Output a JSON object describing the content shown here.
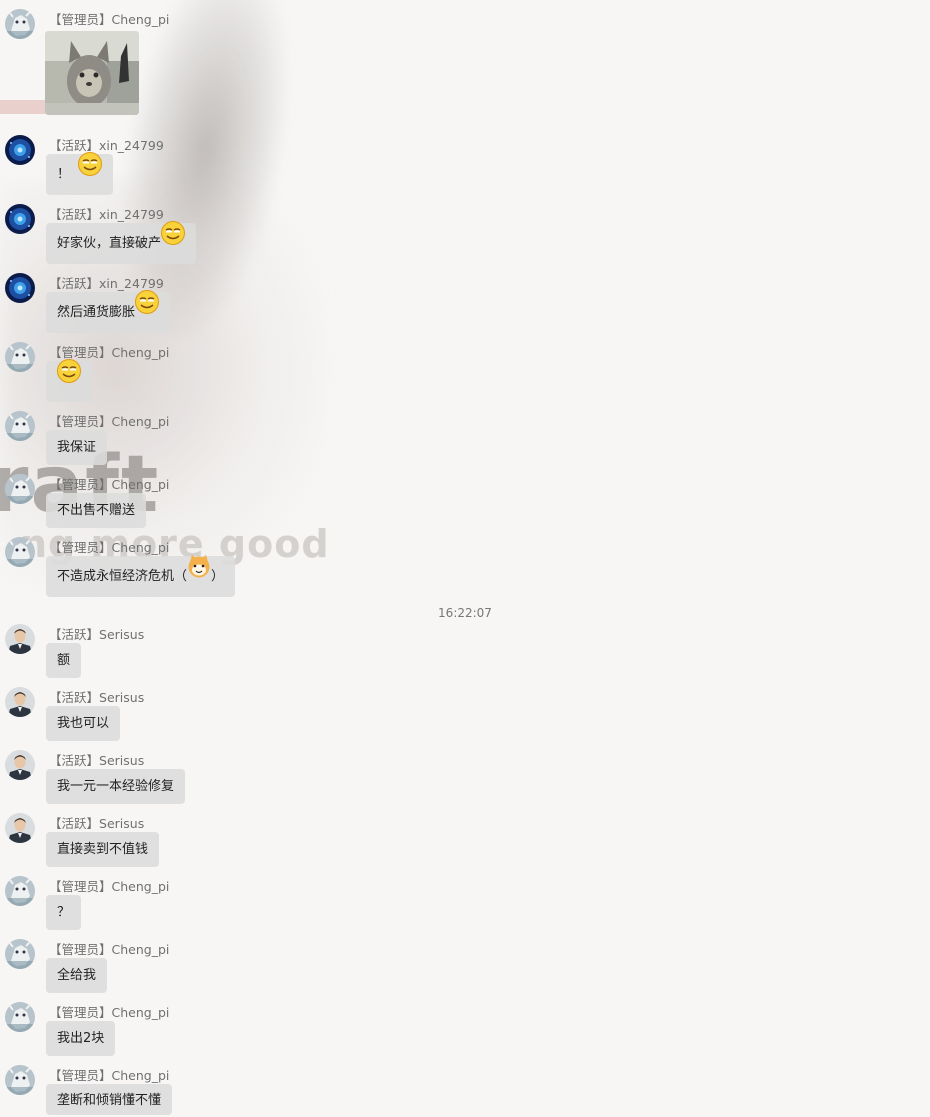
{
  "chat": {
    "timestamp": "16:22:07",
    "messages": [
      {
        "role": "【管理员】",
        "name": "Cheng_pi",
        "avatar": "polar-bear-avatar",
        "type": "image",
        "image": "cat-photo"
      },
      {
        "role": "【活跃】",
        "name": "xin_24799",
        "avatar": "blue-galaxy-avatar",
        "text": "！",
        "emoji": "grin-face-emoji"
      },
      {
        "role": "【活跃】",
        "name": "xin_24799",
        "avatar": "blue-galaxy-avatar",
        "text": "好家伙，直接破产",
        "emoji": "grin-face-emoji"
      },
      {
        "role": "【活跃】",
        "name": "xin_24799",
        "avatar": "blue-galaxy-avatar",
        "text": "然后通货膨胀",
        "emoji": "grin-face-emoji"
      },
      {
        "role": "【管理员】",
        "name": "Cheng_pi",
        "avatar": "polar-bear-avatar",
        "text": "",
        "emoji": "grin-face-emoji"
      },
      {
        "role": "【管理员】",
        "name": "Cheng_pi",
        "avatar": "polar-bear-avatar",
        "text": "我保证"
      },
      {
        "role": "【管理员】",
        "name": "Cheng_pi",
        "avatar": "polar-bear-avatar",
        "text": "不出售不赠送"
      },
      {
        "role": "【管理员】",
        "name": "Cheng_pi",
        "avatar": "polar-bear-avatar",
        "text": "不造成永恒经济危机（",
        "emoji": "shiba-dog-emoji",
        "text_after": "）"
      },
      {
        "role": "【活跃】",
        "name": "Serisus",
        "avatar": "man-in-suit-avatar",
        "text": "额"
      },
      {
        "role": "【活跃】",
        "name": "Serisus",
        "avatar": "man-in-suit-avatar",
        "text": "我也可以"
      },
      {
        "role": "【活跃】",
        "name": "Serisus",
        "avatar": "man-in-suit-avatar",
        "text": "我一元一本经验修复"
      },
      {
        "role": "【活跃】",
        "name": "Serisus",
        "avatar": "man-in-suit-avatar",
        "text": "直接卖到不值钱"
      },
      {
        "role": "【管理员】",
        "name": "Cheng_pi",
        "avatar": "polar-bear-avatar",
        "text": "？"
      },
      {
        "role": "【管理员】",
        "name": "Cheng_pi",
        "avatar": "polar-bear-avatar",
        "text": "全给我"
      },
      {
        "role": "【管理员】",
        "name": "Cheng_pi",
        "avatar": "polar-bear-avatar",
        "text": "我出2块"
      },
      {
        "role": "【管理员】",
        "name": "Cheng_pi",
        "avatar": "polar-bear-avatar",
        "text": "垄断和倾销懂不懂"
      }
    ]
  },
  "background": {
    "word_large": "raft",
    "word_small": "ng more good"
  },
  "colors": {
    "bubble": "#dcdcdc",
    "sender_text": "#707070",
    "message_text": "#222222",
    "background": "#f7f6f5"
  }
}
